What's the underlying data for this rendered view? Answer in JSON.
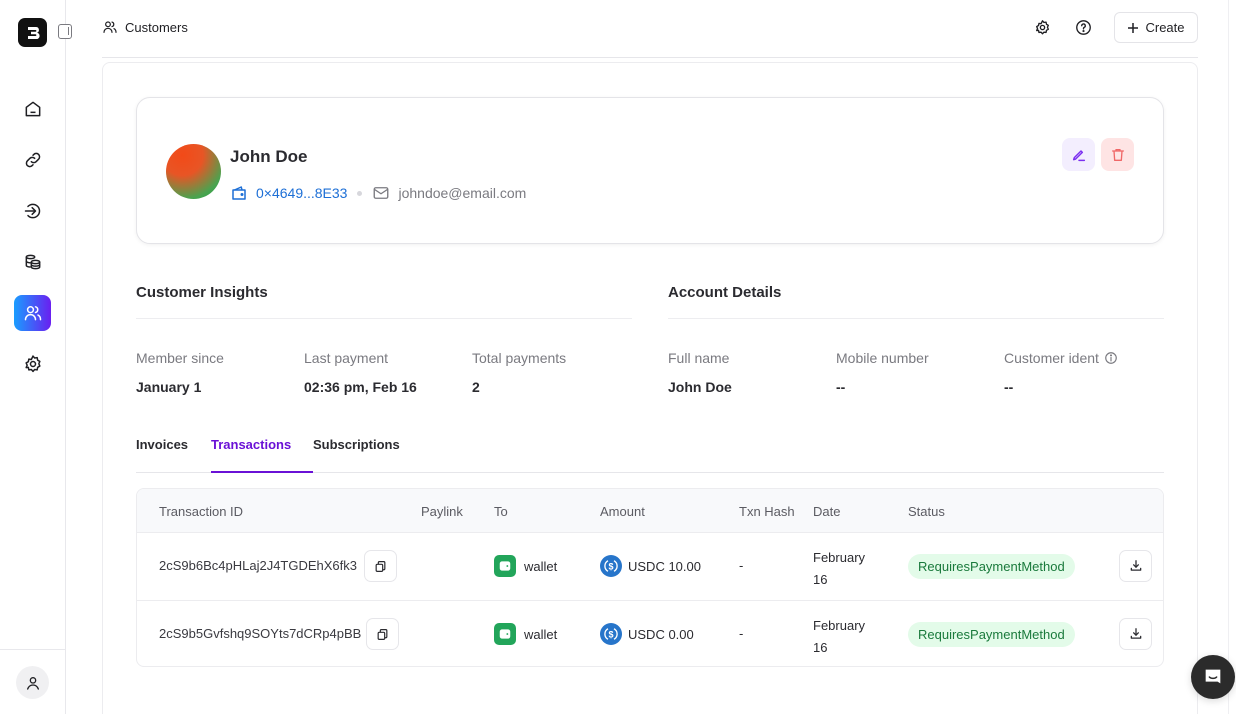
{
  "app": {
    "logo_icon": "brand-logo-icon",
    "panel_toggle_icon": "sidebar-toggle-icon"
  },
  "sidebar": {
    "items": [
      {
        "id": "home",
        "icon": "home-icon",
        "active": false
      },
      {
        "id": "paylinks",
        "icon": "link-icon",
        "active": false
      },
      {
        "id": "payments",
        "icon": "arrow-in-circle-icon",
        "active": false
      },
      {
        "id": "ledger",
        "icon": "coins-stack-icon",
        "active": false
      },
      {
        "id": "customers",
        "icon": "users-icon",
        "active": true
      },
      {
        "id": "settings",
        "icon": "gear-icon",
        "active": false
      }
    ],
    "user_icon": "user-icon"
  },
  "header": {
    "breadcrumb_icon": "users-icon",
    "title": "Customers",
    "settings_icon": "gear-icon",
    "help_icon": "question-circle-icon",
    "create_label": "Create"
  },
  "profile": {
    "name": "John Doe",
    "wallet_address": "0×4649...8E33",
    "email": "johndoe@email.com",
    "edit_icon": "pencil-icon",
    "delete_icon": "trash-icon"
  },
  "insights": {
    "title": "Customer Insights",
    "stats": [
      {
        "label": "Member since",
        "value": "January 1"
      },
      {
        "label": "Last payment",
        "value": "02:36 pm, Feb 16"
      },
      {
        "label": "Total payments",
        "value": "2"
      }
    ]
  },
  "account": {
    "title": "Account Details",
    "stats": [
      {
        "label": "Full name",
        "value": "John Doe"
      },
      {
        "label": "Mobile number",
        "value": "--"
      },
      {
        "label": "Customer ident",
        "value": "--",
        "info_icon": "info-icon"
      }
    ]
  },
  "tabs": [
    {
      "label": "Invoices",
      "active": false
    },
    {
      "label": "Transactions",
      "active": true
    },
    {
      "label": "Subscriptions",
      "active": false
    }
  ],
  "table": {
    "columns": [
      "Transaction ID",
      "Paylink",
      "To",
      "Amount",
      "Txn Hash",
      "Date",
      "Status"
    ],
    "rows": [
      {
        "transaction_id": "2cS9b6Bc4pHLaj2J4TGDEhX6fk3",
        "paylink": "",
        "to": "wallet",
        "amount": "USDC 10.00",
        "txn_hash": "-",
        "date_line1": "February",
        "date_line2": "16",
        "status": "RequiresPaymentMethod"
      },
      {
        "transaction_id": "2cS9b5Gvfshq9SOYts7dCRp4pBB",
        "paylink": "",
        "to": "wallet",
        "amount": "USDC 0.00",
        "txn_hash": "-",
        "date_line1": "February",
        "date_line2": "16",
        "status": "RequiresPaymentMethod"
      }
    ]
  },
  "colors": {
    "accent": "#6a11d6",
    "link": "#1d6fd6",
    "status_bg": "#e3fbe9",
    "status_text": "#1a7a3c",
    "wallet_green": "#22a55a",
    "usdc_blue": "#2775ca"
  },
  "chat_icon": "chat-bubble-icon"
}
